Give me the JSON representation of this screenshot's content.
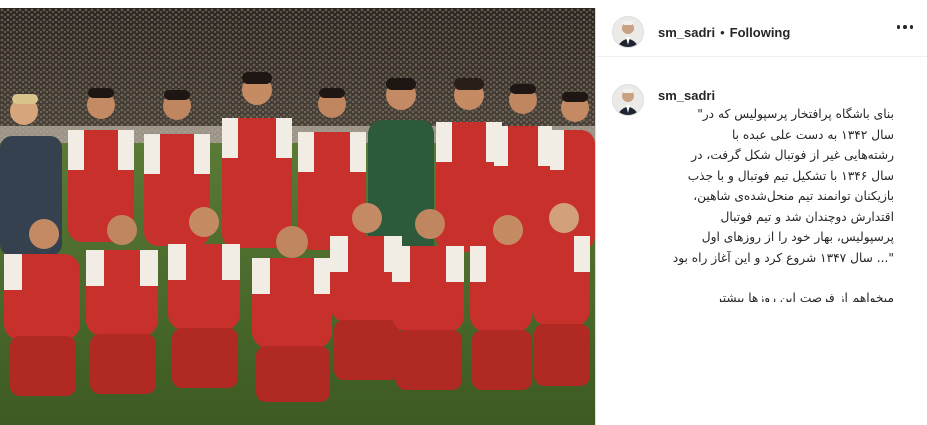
{
  "post": {
    "author": "sm_sadri",
    "separator": "•",
    "follow_status": "Following",
    "caption_lines": [
      "بنای باشگاه پرافتخار پرسپولیس که در\"",
      "سال ۱۳۴۲ به دست علی عبده با",
      "رشته‌هایی غیر از فوتبال شکل گرفت، در",
      "سال ۱۳۴۶ با تشکیل تیم فوتبال و با جذب",
      "بازیکنان توانمند تیم منحل‌شده‌ی شاهین،",
      "اقتدارش دوچندان شد و تیم فوتبال",
      "پرسپولیس، بهار خود را از روزهای اول",
      "\"... سال ۱۳۴۷ شروع کرد و این آغاز راه بود"
    ],
    "caption_more": "میخواهم از فرصت این روزها بیشتر"
  },
  "icons": {
    "more": "more-horizontal-icon",
    "avatar": "avatar-image"
  },
  "colors": {
    "jersey_red": "#c8302b",
    "jersey_white": "#f1ece4",
    "pitch": "#4a6a2c",
    "text": "#262626"
  }
}
